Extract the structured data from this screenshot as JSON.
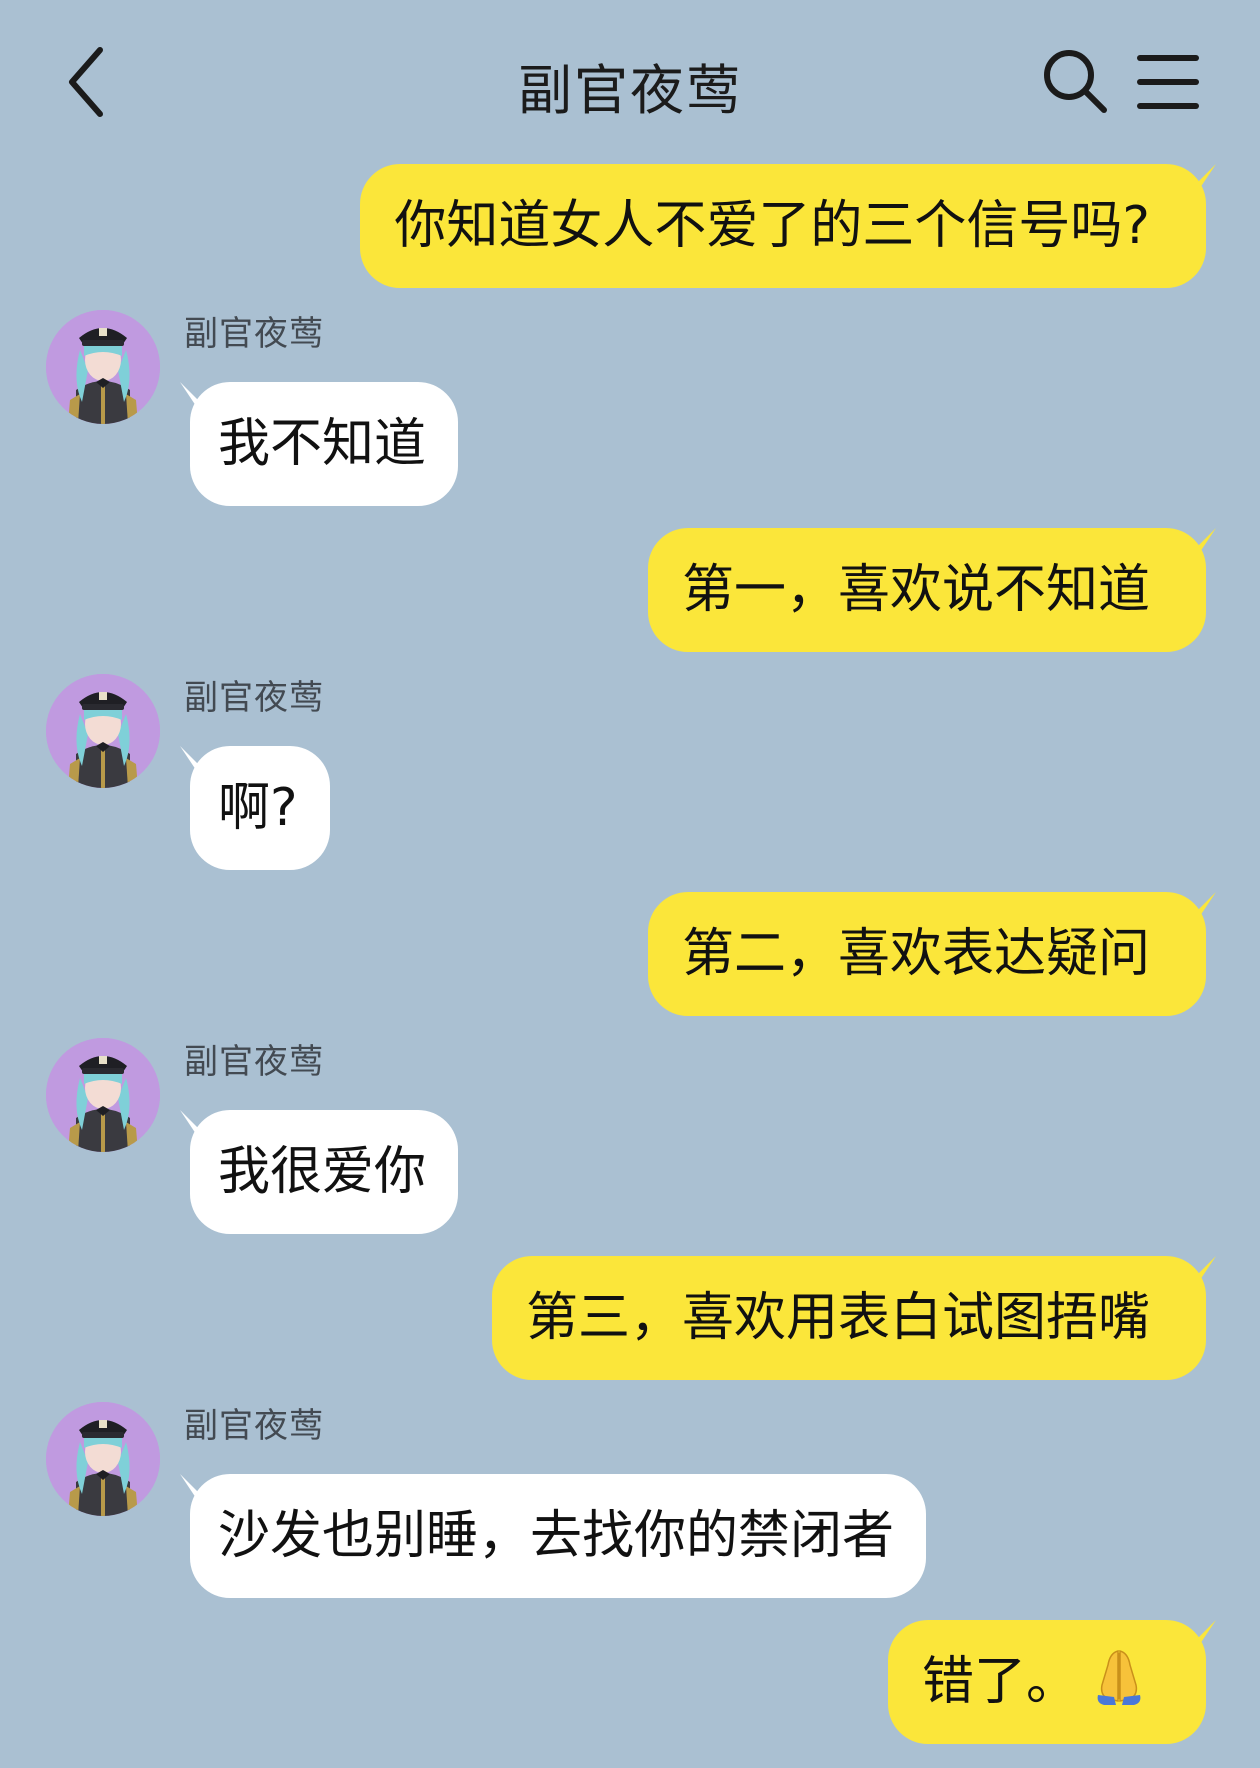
{
  "header": {
    "title": "副官夜莺",
    "back_icon": "chevron-left-icon",
    "search_icon": "search-icon",
    "menu_icon": "menu-icon"
  },
  "colors": {
    "background": "#aac0d2",
    "outgoing_bubble": "#fbe63a",
    "incoming_bubble": "#ffffff",
    "avatar_bg": "#c09ae0"
  },
  "messages": [
    {
      "side": "out",
      "text": "你知道女人不爱了的三个信号吗?"
    },
    {
      "side": "in",
      "sender": "副官夜莺",
      "text": "我不知道"
    },
    {
      "side": "out",
      "text": "第一，喜欢说不知道"
    },
    {
      "side": "in",
      "sender": "副官夜莺",
      "text": "啊?"
    },
    {
      "side": "out",
      "text": "第二，喜欢表达疑问"
    },
    {
      "side": "in",
      "sender": "副官夜莺",
      "text": "我很爱你"
    },
    {
      "side": "out",
      "text": "第三，喜欢用表白试图捂嘴"
    },
    {
      "side": "in",
      "sender": "副官夜莺",
      "text": "沙发也别睡，去找你的禁闭者"
    },
    {
      "side": "out",
      "text": "错了。",
      "emoji": "folded-hands-emoji"
    }
  ]
}
